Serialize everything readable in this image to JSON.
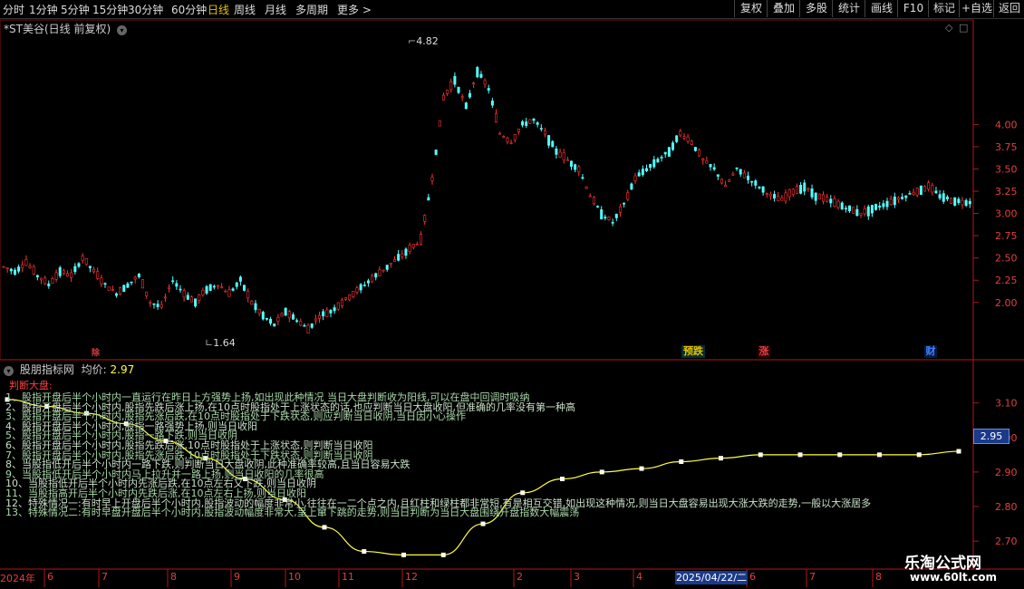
{
  "toolbar": {
    "periods": [
      "分时",
      "1分钟",
      "5分钟",
      "15分钟",
      "30分钟",
      "60分钟",
      "日线",
      "周线",
      "月线",
      "多周期",
      "更多 >"
    ],
    "active_period": "日线",
    "tools": [
      "复权",
      "叠加",
      "多股",
      "统计",
      "画线",
      "F10",
      "标记",
      "+自选",
      "返回"
    ]
  },
  "price_panel": {
    "title": "*ST美谷(日线 前复权)",
    "high_label": "4.82",
    "low_label": "1.64",
    "events": [
      {
        "text": "除",
        "color": "#e04040"
      },
      {
        "text": "预跌",
        "color": "#e8c000"
      },
      {
        "text": "涨",
        "color": "#e04040"
      },
      {
        "text": "财",
        "color": "#4080ff"
      }
    ]
  },
  "indicator_panel": {
    "name": "股朋指标网",
    "avg_label": "均价:",
    "avg_value": "2.97",
    "current_value": "2.95",
    "heading": "判断大盘:",
    "tips": [
      "1、股指开盘后半个小时内一直运行在昨日上方强势上扬,如出现此种情况 当日大盘判断收为阳线,可以在盘中回调时吸纳",
      "2、股指开盘后半个小时内,股指先跌后涨上扬,在10点时股指处于上涨状态的话,也应判断当日大盘收阳,但准确的几率没有第一种高",
      "3、股指开盘后半个小时内,股指先涨后跌,在10点时股指处于下跌状态,则应判断当日收阴,当日因小心操作",
      "4、股指开盘后半个小时内,股指一路强势上扬,则当日收阳",
      "5、股指开盘后半个小时内,股指一路下跌,则当日收阴",
      "6、股指开盘后半个小时内,股指先跌后涨,10点时股指处于上涨状态,则判断当日收阳",
      "7、股指开盘后半个小时内,股指先涨后跌,10点时股指处于下跌状态,则判断当日收阴",
      "8、当股指低开后半个小时内一路下跌,则判断当日大盘收阴,此种准确率较高,且当日容易大跌",
      "9、当股指低开后半个小时内马上拉升并一路上扬,则当日收阳的几率很高",
      "10、当股指低开后半个小时内先涨后跌,在10点左右又下跌,则当日收阴",
      "11、当股指高开后半个小时内先跌后涨,在10点左右上扬,则当日收阳",
      "12、特殊情况一:有时早上开盘后半个小时内,股指波动的幅度非常小,往往在一二个点之内,且红柱和绿柱都非常短,有是相互交错,如出现这种情况,则当日大盘容易出现大涨大跌的走势,一般以大涨居多",
      "13、特殊情况二:有时早盘开盘后半个小时内,股指波动幅度非常大,呈上窜下跳的走势,则当日判断为当日大盘围绕开盘指数大幅震荡"
    ]
  },
  "x_axis": {
    "year_label": "2024年",
    "months": [
      "6",
      "7",
      "8",
      "9",
      "10",
      "11",
      "12",
      "2",
      "3",
      "4",
      "6",
      "7",
      "8"
    ],
    "cursor_date": "2025/04/22/二"
  },
  "watermark": {
    "title": "乐淘公式网",
    "url": "www.60lt.com"
  },
  "chart_data": [
    {
      "type": "candlestick",
      "title": "*ST美谷(日线 前复权)",
      "y_ticks": [
        2.0,
        2.25,
        2.5,
        2.75,
        3.0,
        3.25,
        3.5,
        3.75,
        4.0
      ],
      "ylim": [
        1.55,
        4.95
      ],
      "low": 1.64,
      "high": 4.82,
      "up_color": "#ff3232",
      "down_color": "#54ffff",
      "closes_approx": [
        2.4,
        2.35,
        2.45,
        2.3,
        2.2,
        2.35,
        2.3,
        2.5,
        2.35,
        2.2,
        2.1,
        2.2,
        2.3,
        2.0,
        1.95,
        2.25,
        2.1,
        2.0,
        2.15,
        2.2,
        2.1,
        2.25,
        2.0,
        1.85,
        1.75,
        1.9,
        1.8,
        1.7,
        1.85,
        1.9,
        2.0,
        2.1,
        2.2,
        2.3,
        2.4,
        2.5,
        2.6,
        2.7,
        3.4,
        4.3,
        4.5,
        4.2,
        4.6,
        4.4,
        3.9,
        3.8,
        4.0,
        4.05,
        3.9,
        3.7,
        3.6,
        3.5,
        3.2,
        3.0,
        2.9,
        3.1,
        3.4,
        3.5,
        3.6,
        3.7,
        3.9,
        3.8,
        3.6,
        3.5,
        3.3,
        3.5,
        3.4,
        3.3,
        3.2,
        3.15,
        3.25,
        3.3,
        3.2,
        3.15,
        3.1,
        3.05,
        3.0,
        3.05,
        3.1,
        3.15,
        3.2,
        3.25,
        3.3,
        3.2,
        3.15,
        3.13
      ]
    },
    {
      "type": "line",
      "title": "股朋指标网",
      "y_ticks": [
        2.7,
        2.8,
        2.9,
        3.0,
        3.1
      ],
      "ylim": [
        2.64,
        3.17
      ],
      "series": [
        {
          "color": "#ffff40",
          "values": [
            3.11,
            3.09,
            3.07,
            3.04,
            2.99,
            2.94,
            2.88,
            2.82,
            2.74,
            2.67,
            2.66,
            2.66,
            2.75,
            2.84,
            2.88,
            2.9,
            2.91,
            2.93,
            2.94,
            2.95,
            2.95,
            2.95,
            2.95,
            2.95,
            2.96
          ]
        }
      ]
    }
  ]
}
